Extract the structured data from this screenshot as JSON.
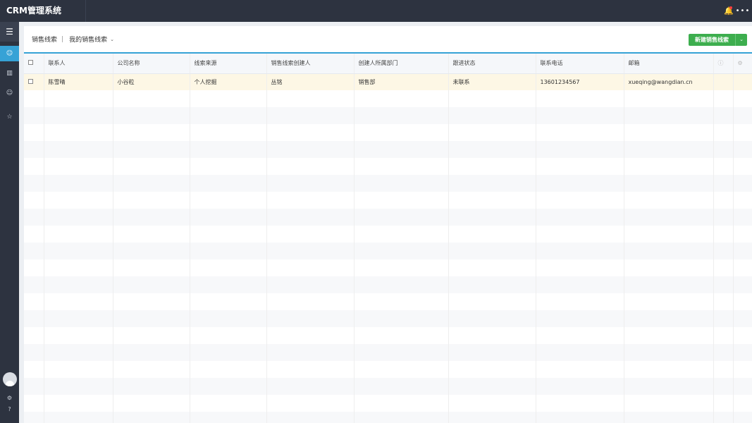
{
  "app": {
    "title": "CRM管理系统"
  },
  "topbar": {
    "bell_icon": "bell-icon",
    "more_icon": "more-icon"
  },
  "sidebar": {
    "items": [
      {
        "icon": "menu-icon",
        "glyph": "☰"
      },
      {
        "icon": "leads-icon",
        "glyph": "👤"
      },
      {
        "icon": "chart-icon",
        "glyph": "▥"
      },
      {
        "icon": "user-icon",
        "glyph": "👤"
      },
      {
        "icon": "star-icon",
        "glyph": "☆"
      }
    ],
    "bottom": [
      {
        "icon": "gear-icon",
        "glyph": "⚙"
      },
      {
        "icon": "help-icon",
        "glyph": "?"
      }
    ]
  },
  "panel": {
    "title": "销售线索",
    "separator": "|",
    "filter_value": "我的销售线索",
    "new_button": "新建销售线索"
  },
  "table": {
    "columns": [
      "联系人",
      "公司名称",
      "线索来源",
      "销售线索创建人",
      "创建人所属部门",
      "跟进状态",
      "联系电话",
      "邮箱"
    ],
    "rows": [
      {
        "contact": "陈雪晴",
        "company": "小谷粒",
        "source": "个人挖掘",
        "creator": "丛铭",
        "department": "销售部",
        "status": "未联系",
        "phone": "13601234567",
        "email": "xueqing@wangdian.cn"
      }
    ]
  },
  "colors": {
    "accent": "#36a2d6",
    "primary_button": "#3dae4e",
    "sidebar_bg": "#2d3340",
    "selected_row": "#fdf7e5"
  }
}
